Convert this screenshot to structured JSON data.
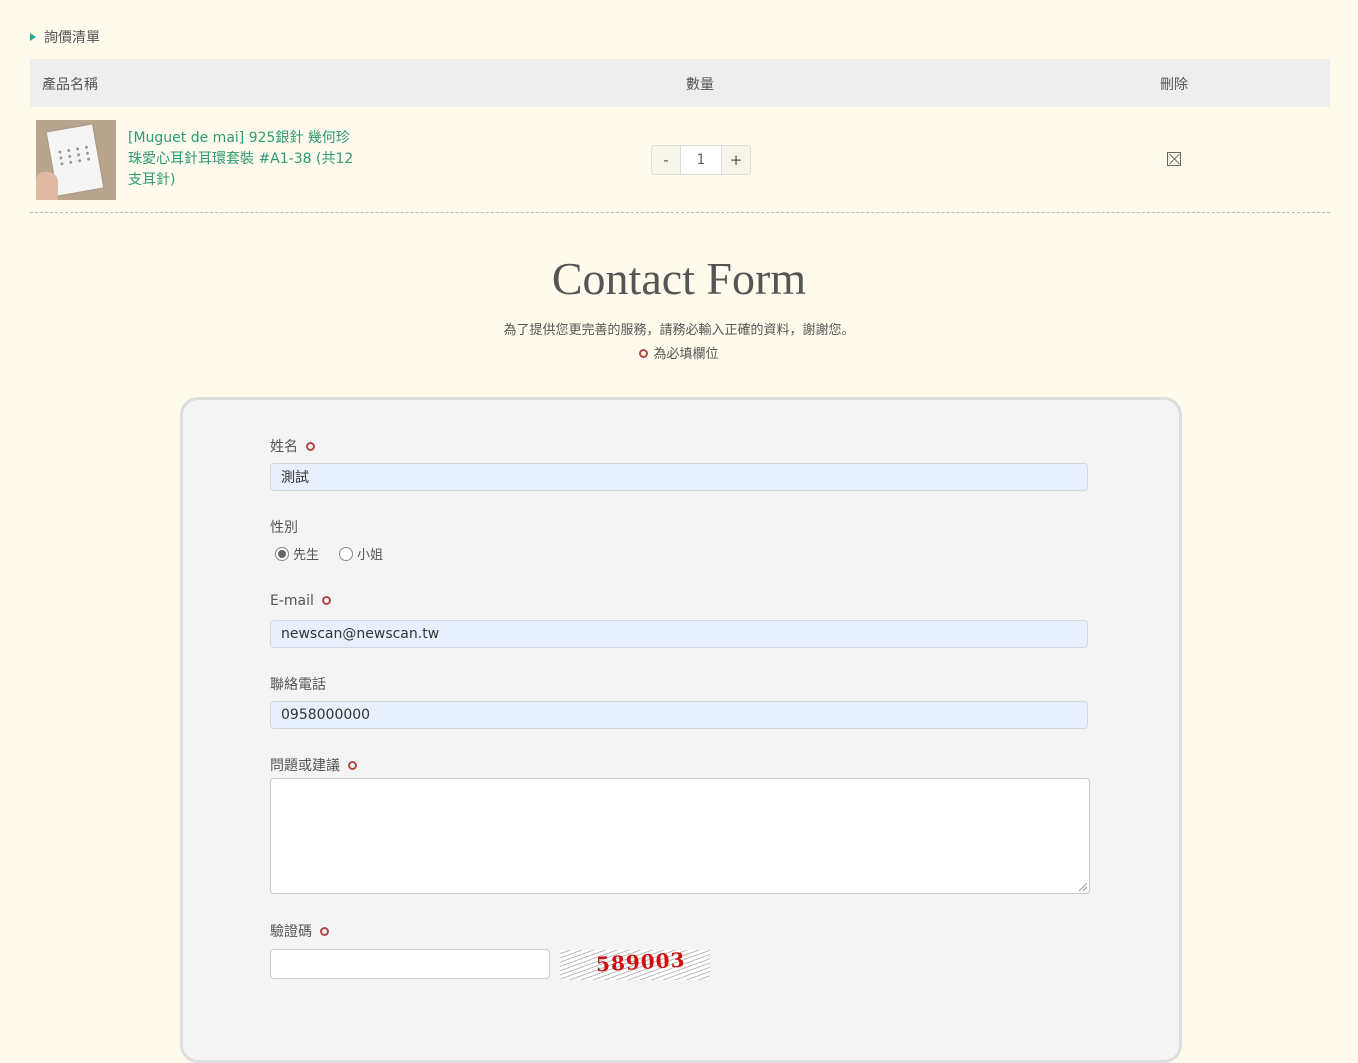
{
  "breadcrumb": {
    "label": "詢價清單"
  },
  "cart": {
    "headers": {
      "name": "產品名稱",
      "qty": "數量",
      "delete": "刪除"
    },
    "items": [
      {
        "name": "[Muguet de mai] 925銀針 幾何珍珠愛心耳針耳環套裝 #A1-38 (共12支耳針)",
        "quantity": "1",
        "minus_label": "-",
        "plus_label": "+",
        "delete_icon": "close-box-icon"
      }
    ]
  },
  "form": {
    "title": "Contact Form",
    "note": "為了提供您更完善的服務，請務必輸入正確的資料，謝謝您。",
    "required_note": "為必填欄位",
    "fields": {
      "name": {
        "label": "姓名",
        "value": "測試",
        "required": true
      },
      "gender": {
        "label": "性別",
        "options": [
          "先生",
          "小姐"
        ],
        "selected": "先生"
      },
      "email": {
        "label": "E-mail",
        "value": "newscan@newscan.tw",
        "required": true
      },
      "phone": {
        "label": "聯絡電話",
        "value": "0958000000"
      },
      "message": {
        "label": "問題或建議",
        "value": "",
        "required": true
      },
      "captcha": {
        "label": "驗證碼",
        "value": "",
        "image_text": "589003",
        "required": true
      }
    }
  },
  "colors": {
    "page_bg": "#fefaec",
    "accent_green": "#2e9a72",
    "required_red": "#b04a4a",
    "captcha_red": "#d01010"
  }
}
